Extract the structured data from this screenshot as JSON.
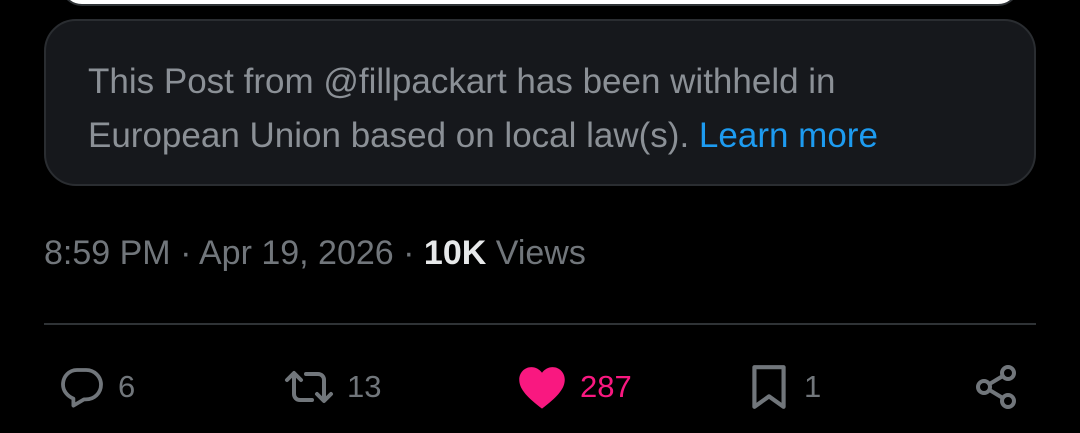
{
  "notice": {
    "text": "This Post from @fillpackart has been withheld in European Union based on local law(s).",
    "link": "Learn more"
  },
  "meta": {
    "time": "8:59 PM",
    "sep1": "·",
    "date": "Apr 19, 2026",
    "sep2": "·",
    "views_count": "10K",
    "views_label": "Views"
  },
  "actions": {
    "replies": "6",
    "reposts": "13",
    "likes": "287",
    "bookmarks": "1"
  },
  "colors": {
    "accent": "#1d9bf0",
    "like": "#f91880",
    "muted": "#71767b"
  },
  "icons": [
    "reply-icon",
    "repost-icon",
    "heart-icon",
    "bookmark-icon",
    "share-icon"
  ]
}
